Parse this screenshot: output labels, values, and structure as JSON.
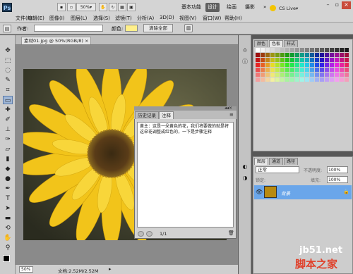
{
  "app": {
    "logo": "Ps",
    "zoom": "50%",
    "essentials": "基本功能",
    "design": "设计",
    "painting": "绘画",
    "photography": "摄影",
    "more": "»",
    "cs_live": "CS Live▾"
  },
  "menu": [
    "文件(F)",
    "编辑(E)",
    "图像(I)",
    "图层(L)",
    "选择(S)",
    "滤镜(T)",
    "分析(A)",
    "3D(D)",
    "视图(V)",
    "窗口(W)",
    "帮助(H)"
  ],
  "options": {
    "author_label": "作者:",
    "color_label": "颜色:",
    "clear_all": "清除全部",
    "note_color": "#ffef8a"
  },
  "document": {
    "tab": "素材01.jpg @ 50%(RGB/8)",
    "close": "×"
  },
  "status": {
    "zoom": "50%",
    "doc_info": "文档:2.52M/2.52M"
  },
  "notes_panel": {
    "tab_history": "历史记录",
    "tab_notes": "注释",
    "text": "黄主：这是一朵黄色的花，我们将要做的就是将这朵花调整成红色的，一下是步骤注释",
    "page": "1/1"
  },
  "swatches_panel": {
    "tab_color": "颜色",
    "tab_swatches": "色板",
    "tab_styles": "样式"
  },
  "layers_panel": {
    "tab_layers": "图层",
    "tab_channels": "通道",
    "tab_paths": "路径",
    "blend_mode": "正常",
    "opacity_label": "不透明度:",
    "opacity": "100%",
    "lock_label": "锁定:",
    "fill_label": "填充:",
    "fill": "100%",
    "layer_name": "背景"
  },
  "watermark": {
    "site": "jb51.net",
    "name": "脚本之家"
  }
}
